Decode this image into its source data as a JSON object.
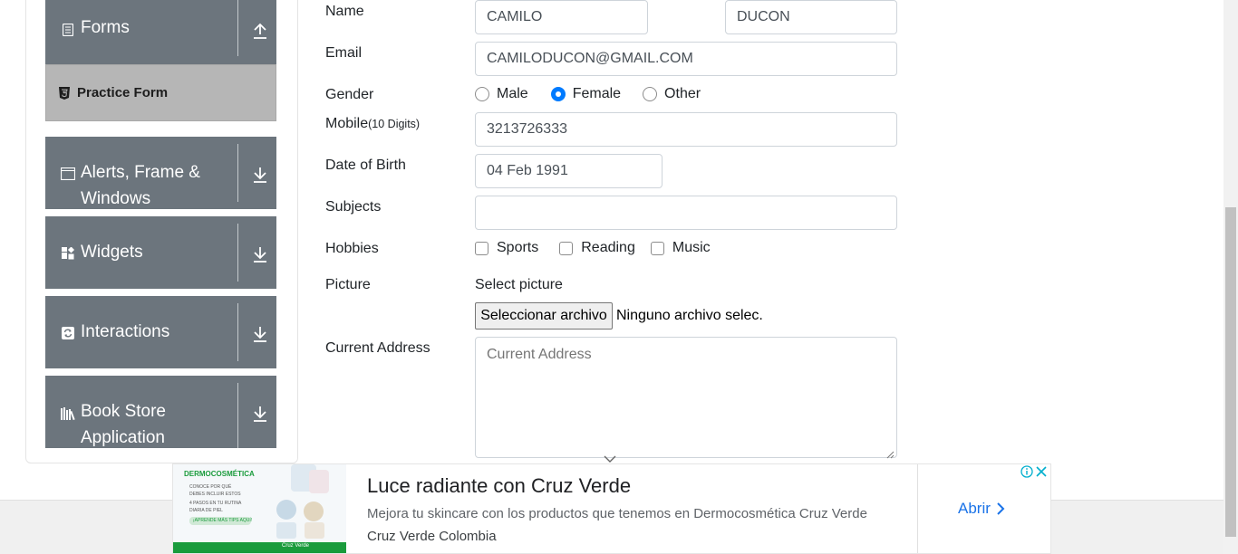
{
  "sidebar": {
    "groups": [
      {
        "title": "Forms",
        "icon": "form-icon",
        "arrow": "collapse-up"
      },
      {
        "title_line1": "Alerts, Frame &",
        "title_line2": "Windows",
        "icon": "window-icon",
        "arrow": "expand-down"
      },
      {
        "title": "Widgets",
        "icon": "widgets-icon",
        "arrow": "expand-down"
      },
      {
        "title": "Interactions",
        "icon": "interactions-icon",
        "arrow": "expand-down"
      },
      {
        "title_line1": "Book Store",
        "title_line2": "Application",
        "icon": "bookstore-icon",
        "arrow": "expand-down"
      }
    ],
    "active_item": "Practice Form"
  },
  "form": {
    "name_label": "Name",
    "first_name": "CAMILO",
    "last_name": "DUCON",
    "email_label": "Email",
    "email": "CAMILODUCON@GMAIL.COM",
    "gender_label": "Gender",
    "gender_options": [
      "Male",
      "Female",
      "Other"
    ],
    "gender_selected": "Female",
    "mobile_label": "Mobile",
    "mobile_hint": "(10 Digits)",
    "mobile": "3213726333",
    "dob_label": "Date of Birth",
    "dob": "04 Feb 1991",
    "subjects_label": "Subjects",
    "subjects": "",
    "hobbies_label": "Hobbies",
    "hobbies": [
      "Sports",
      "Reading",
      "Music"
    ],
    "picture_label": "Picture",
    "picture_select_text": "Select picture",
    "file_button": "Seleccionar archivo",
    "file_status": "Ninguno archivo selec.",
    "address_label": "Current Address",
    "address_placeholder": "Current Address"
  },
  "ad": {
    "title": "Luce radiante con Cruz Verde",
    "description": "Mejora tu skincare con los productos que tenemos en Dermocosmética Cruz Verde",
    "source": "Cruz Verde Colombia",
    "cta": "Abrir",
    "image_brand": "DERMOCOSMÉTICA",
    "image_lines": [
      "CONOCE POR QUÉ",
      "DEBES INCLUIR ESTOS",
      "4 PASOS EN TU RUTINA",
      "DIARIA DE PIEL",
      "¡APRENDE MÁS TIPS AQUÍ!"
    ],
    "image_footer": "Cruz Verde",
    "colors": {
      "cta": "#1a73e8",
      "brand_green": "#1a9b3c"
    }
  },
  "colors": {
    "sidebar_group": "#6c757d",
    "sidebar_active": "#b6b6b6",
    "radio_checked": "#007bff"
  }
}
